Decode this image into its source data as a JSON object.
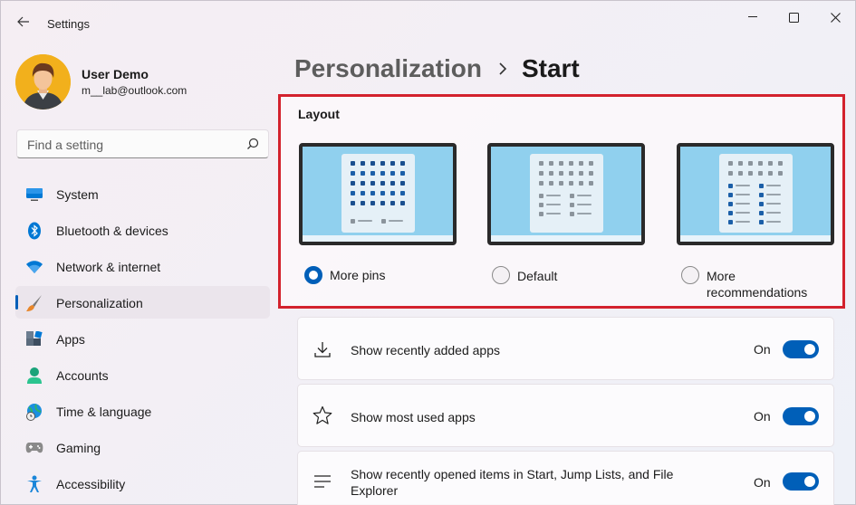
{
  "window": {
    "title": "Settings"
  },
  "user": {
    "name": "User Demo",
    "email": "m__lab@outlook.com"
  },
  "search": {
    "placeholder": "Find a setting"
  },
  "sidebar": {
    "items": [
      {
        "label": "System",
        "icon": "monitor-icon"
      },
      {
        "label": "Bluetooth & devices",
        "icon": "bluetooth-icon"
      },
      {
        "label": "Network & internet",
        "icon": "wifi-icon"
      },
      {
        "label": "Personalization",
        "icon": "brush-icon",
        "active": true
      },
      {
        "label": "Apps",
        "icon": "apps-icon"
      },
      {
        "label": "Accounts",
        "icon": "person-icon"
      },
      {
        "label": "Time & language",
        "icon": "globe-clock-icon"
      },
      {
        "label": "Gaming",
        "icon": "gamepad-icon"
      },
      {
        "label": "Accessibility",
        "icon": "accessibility-icon"
      }
    ]
  },
  "breadcrumb": {
    "parent": "Personalization",
    "current": "Start"
  },
  "layout": {
    "title": "Layout",
    "options": [
      {
        "label": "More pins",
        "checked": true
      },
      {
        "label": "Default",
        "checked": false
      },
      {
        "label": "More recommendations",
        "checked": false
      }
    ]
  },
  "settings": [
    {
      "label": "Show recently added apps",
      "state": "On",
      "icon": "download-icon",
      "on": true
    },
    {
      "label": "Show most used apps",
      "state": "On",
      "icon": "star-icon",
      "on": true
    },
    {
      "label": "Show recently opened items in Start, Jump Lists, and File Explorer",
      "state": "On",
      "icon": "list-icon",
      "on": true
    }
  ],
  "colors": {
    "accent": "#005fb8",
    "highlight_border": "#d3222d"
  }
}
